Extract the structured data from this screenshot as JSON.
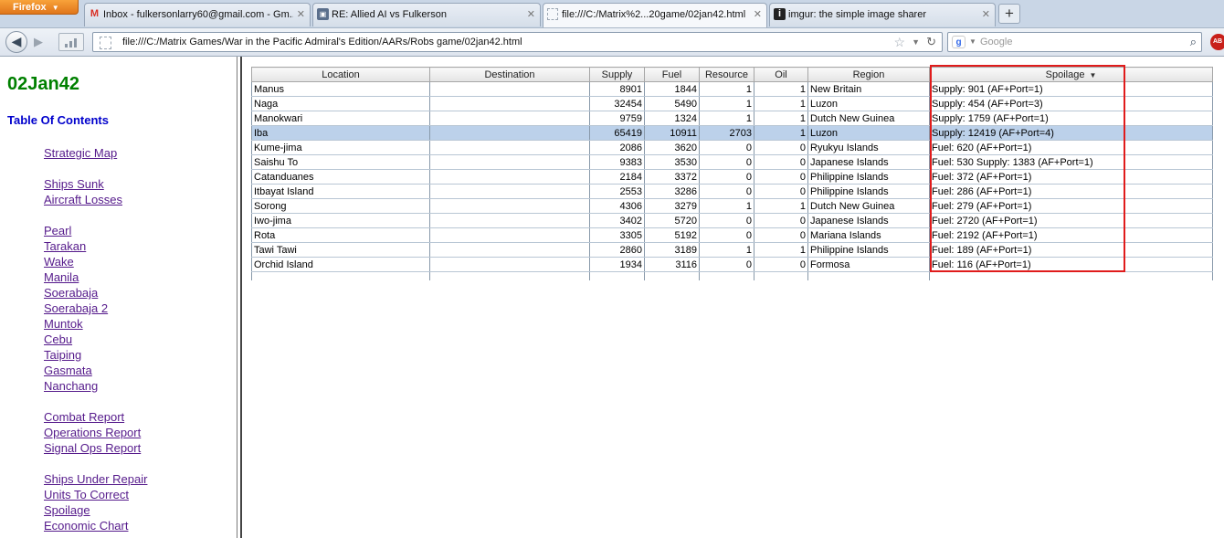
{
  "browser": {
    "menu_button": "Firefox",
    "tabs": [
      {
        "label": "Inbox - fulkersonlarry60@gmail.com - Gm...",
        "icon": "gmail-icon"
      },
      {
        "label": "RE: Allied AI vs Fulkerson",
        "icon": "forum-icon"
      },
      {
        "label": "file:///C:/Matrix%2...20game/02jan42.html",
        "icon": "page-icon",
        "active": true
      },
      {
        "label": "imgur: the simple image sharer",
        "icon": "imgur-icon"
      }
    ],
    "url": "file:///C:/Matrix Games/War in the Pacific Admiral's Edition/AARs/Robs game/02jan42.html",
    "search_placeholder": "Google"
  },
  "sidebar": {
    "date": "02Jan42",
    "toc_title": "Table Of Contents",
    "links": [
      "Strategic Map",
      "Ships Sunk",
      "Aircraft Losses",
      "Pearl",
      "Tarakan",
      "Wake",
      "Manila",
      "Soerabaja",
      "Soerabaja 2",
      "Muntok",
      "Cebu",
      "Taiping",
      "Gasmata",
      "Nanchang",
      "Combat Report",
      "Operations Report",
      "Signal Ops Report",
      "Ships Under Repair",
      "Units To Correct",
      "Spoilage",
      "Economic Chart"
    ]
  },
  "table": {
    "columns": [
      "Location",
      "Destination",
      "Supply",
      "Fuel",
      "Resource",
      "Oil",
      "Region",
      "Spoilage"
    ],
    "sorted_column": "Spoilage",
    "selected_row": 3,
    "rows": [
      [
        "Manus",
        "",
        "8901",
        "1844",
        "1",
        "1",
        "New Britain",
        "Supply: 901 (AF+Port=1)"
      ],
      [
        "Naga",
        "",
        "32454",
        "5490",
        "1",
        "1",
        "Luzon",
        "Supply: 454 (AF+Port=3)"
      ],
      [
        "Manokwari",
        "",
        "9759",
        "1324",
        "1",
        "1",
        "Dutch New Guinea",
        "Supply: 1759 (AF+Port=1)"
      ],
      [
        "Iba",
        "",
        "65419",
        "10911",
        "2703",
        "1",
        "Luzon",
        "Supply: 12419 (AF+Port=4)"
      ],
      [
        "Kume-jima",
        "",
        "2086",
        "3620",
        "0",
        "0",
        "Ryukyu Islands",
        "Fuel: 620 (AF+Port=1)"
      ],
      [
        "Saishu To",
        "",
        "9383",
        "3530",
        "0",
        "0",
        "Japanese Islands",
        "Fuel: 530 Supply: 1383 (AF+Port=1)"
      ],
      [
        "Catanduanes",
        "",
        "2184",
        "3372",
        "0",
        "0",
        "Philippine Islands",
        "Fuel: 372 (AF+Port=1)"
      ],
      [
        "Itbayat Island",
        "",
        "2553",
        "3286",
        "0",
        "0",
        "Philippine Islands",
        "Fuel: 286 (AF+Port=1)"
      ],
      [
        "Sorong",
        "",
        "4306",
        "3279",
        "1",
        "1",
        "Dutch New Guinea",
        "Fuel: 279 (AF+Port=1)"
      ],
      [
        "Iwo-jima",
        "",
        "3402",
        "5720",
        "0",
        "0",
        "Japanese Islands",
        "Fuel: 2720 (AF+Port=1)"
      ],
      [
        "Rota",
        "",
        "3305",
        "5192",
        "0",
        "0",
        "Mariana Islands",
        "Fuel: 2192 (AF+Port=1)"
      ],
      [
        "Tawi Tawi",
        "",
        "2860",
        "3189",
        "1",
        "1",
        "Philippine Islands",
        "Fuel: 189 (AF+Port=1)"
      ],
      [
        "Orchid Island",
        "",
        "1934",
        "3116",
        "0",
        "0",
        "Formosa",
        "Fuel: 116 (AF+Port=1)"
      ]
    ]
  },
  "highlight_color": "#e01b1b"
}
